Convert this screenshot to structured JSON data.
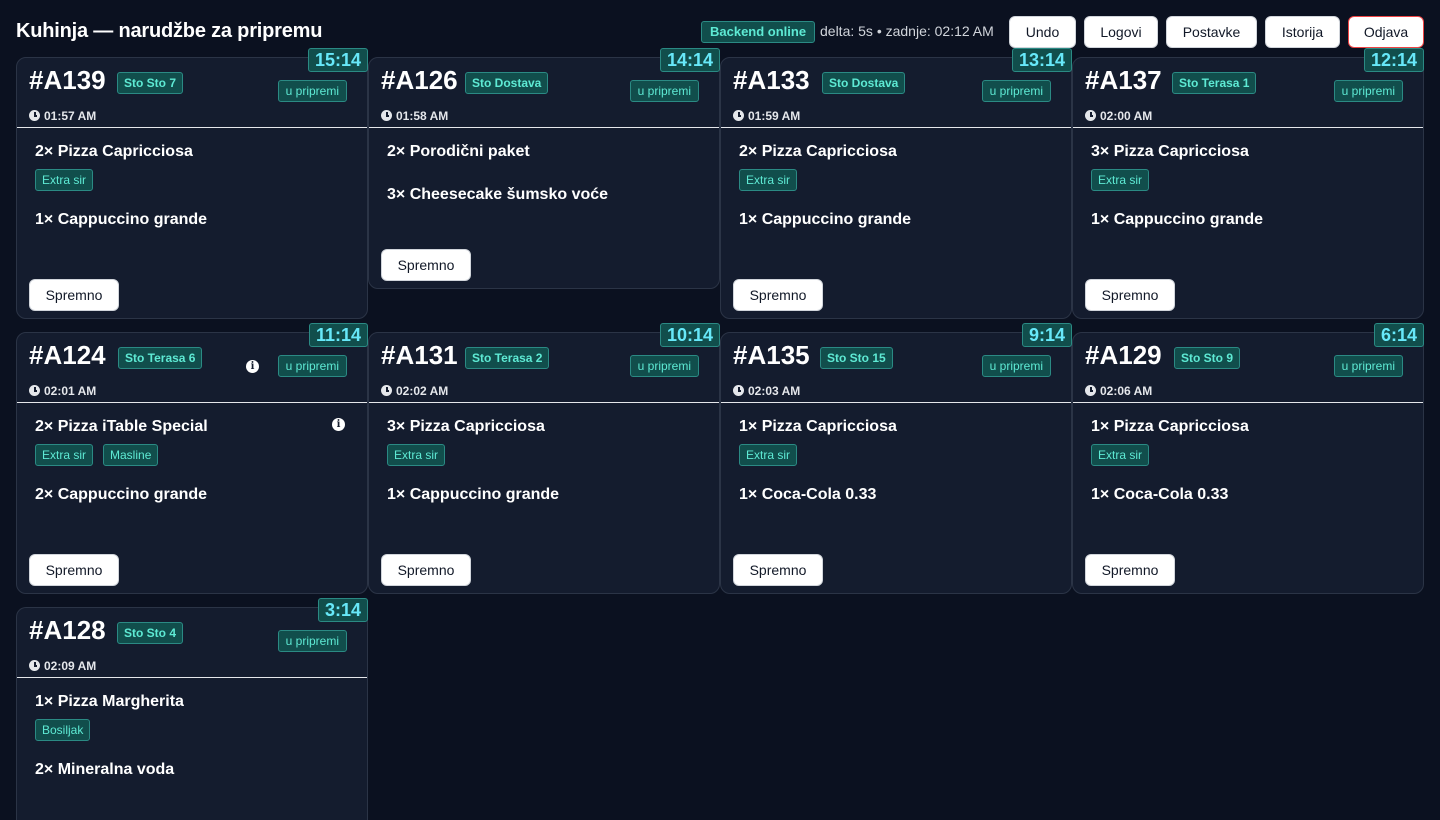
{
  "app": {
    "title": "Kuhinja — narudžbe za pripremu"
  },
  "header": {
    "backend_status": "Backend online",
    "delta_text": "delta: 5s • zadnje: 02:12 AM",
    "buttons": {
      "undo": "Undo",
      "logs": "Logovi",
      "settings": "Postavke",
      "history": "Istorija",
      "logout": "Odjava"
    }
  },
  "labels": {
    "ready_button": "Spremno"
  },
  "orders": [
    {
      "id": "#A139",
      "table": "Sto Sto 7",
      "status": "u pripremi",
      "time": "01:57 AM",
      "timer": "15:14",
      "items": [
        {
          "name": "2× Pizza Capricciosa",
          "mods": [
            "Extra sir"
          ]
        },
        {
          "name": "1× Cappuccino grande",
          "mods": []
        }
      ]
    },
    {
      "id": "#A126",
      "table": "Sto Dostava",
      "status": "u pripremi",
      "time": "01:58 AM",
      "timer": "14:14",
      "items": [
        {
          "name": "2× Porodični paket",
          "mods": []
        },
        {
          "name": "3× Cheesecake šumsko voće",
          "mods": []
        }
      ]
    },
    {
      "id": "#A133",
      "table": "Sto Dostava",
      "status": "u pripremi",
      "time": "01:59 AM",
      "timer": "13:14",
      "items": [
        {
          "name": "2× Pizza Capricciosa",
          "mods": [
            "Extra sir"
          ]
        },
        {
          "name": "1× Cappuccino grande",
          "mods": []
        }
      ]
    },
    {
      "id": "#A137",
      "table": "Sto Terasa 1",
      "status": "u pripremi",
      "time": "02:00 AM",
      "timer": "12:14",
      "items": [
        {
          "name": "3× Pizza Capricciosa",
          "mods": [
            "Extra sir"
          ]
        },
        {
          "name": "1× Cappuccino grande",
          "mods": []
        }
      ]
    },
    {
      "id": "#A124",
      "table": "Sto Terasa 6",
      "status": "u pripremi",
      "time": "02:01 AM",
      "timer": "11:14",
      "items": [
        {
          "name": "2× Pizza iTable Special",
          "mods": [
            "Extra sir",
            "Masline"
          ]
        },
        {
          "name": "2× Cappuccino grande",
          "mods": []
        }
      ]
    },
    {
      "id": "#A131",
      "table": "Sto Terasa 2",
      "status": "u pripremi",
      "time": "02:02 AM",
      "timer": "10:14",
      "items": [
        {
          "name": "3× Pizza Capricciosa",
          "mods": [
            "Extra sir"
          ]
        },
        {
          "name": "1× Cappuccino grande",
          "mods": []
        }
      ]
    },
    {
      "id": "#A135",
      "table": "Sto Sto 15",
      "status": "u pripremi",
      "time": "02:03 AM",
      "timer": "9:14",
      "items": [
        {
          "name": "1× Pizza Capricciosa",
          "mods": [
            "Extra sir"
          ]
        },
        {
          "name": "1× Coca-Cola 0.33",
          "mods": []
        }
      ]
    },
    {
      "id": "#A129",
      "table": "Sto Sto 9",
      "status": "u pripremi",
      "time": "02:06 AM",
      "timer": "6:14",
      "items": [
        {
          "name": "1× Pizza Capricciosa",
          "mods": [
            "Extra sir"
          ]
        },
        {
          "name": "1× Coca-Cola 0.33",
          "mods": []
        }
      ]
    },
    {
      "id": "#A128",
      "table": "Sto Sto 4",
      "status": "u pripremi",
      "time": "02:09 AM",
      "timer": "3:14",
      "items": [
        {
          "name": "1× Pizza Margherita",
          "mods": [
            "Bosiljak"
          ]
        },
        {
          "name": "2× Mineralna voda",
          "mods": []
        }
      ]
    }
  ]
}
